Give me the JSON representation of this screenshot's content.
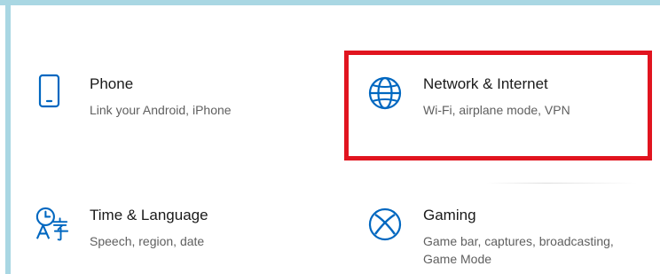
{
  "settings": {
    "tiles": [
      {
        "title": "Phone",
        "description": "Link your Android, iPhone",
        "icon": "phone-icon"
      },
      {
        "title": "Network & Internet",
        "description": "Wi-Fi, airplane mode, VPN",
        "icon": "globe-icon"
      },
      {
        "title": "Time & Language",
        "description": "Speech, region, date",
        "icon": "time-language-icon"
      },
      {
        "title": "Gaming",
        "description": "Game bar, captures, broadcasting, Game Mode",
        "icon": "xbox-icon"
      }
    ]
  },
  "colors": {
    "accent": "#0067c0",
    "highlight": "#e1141f",
    "frame": "#a9d7e3"
  }
}
